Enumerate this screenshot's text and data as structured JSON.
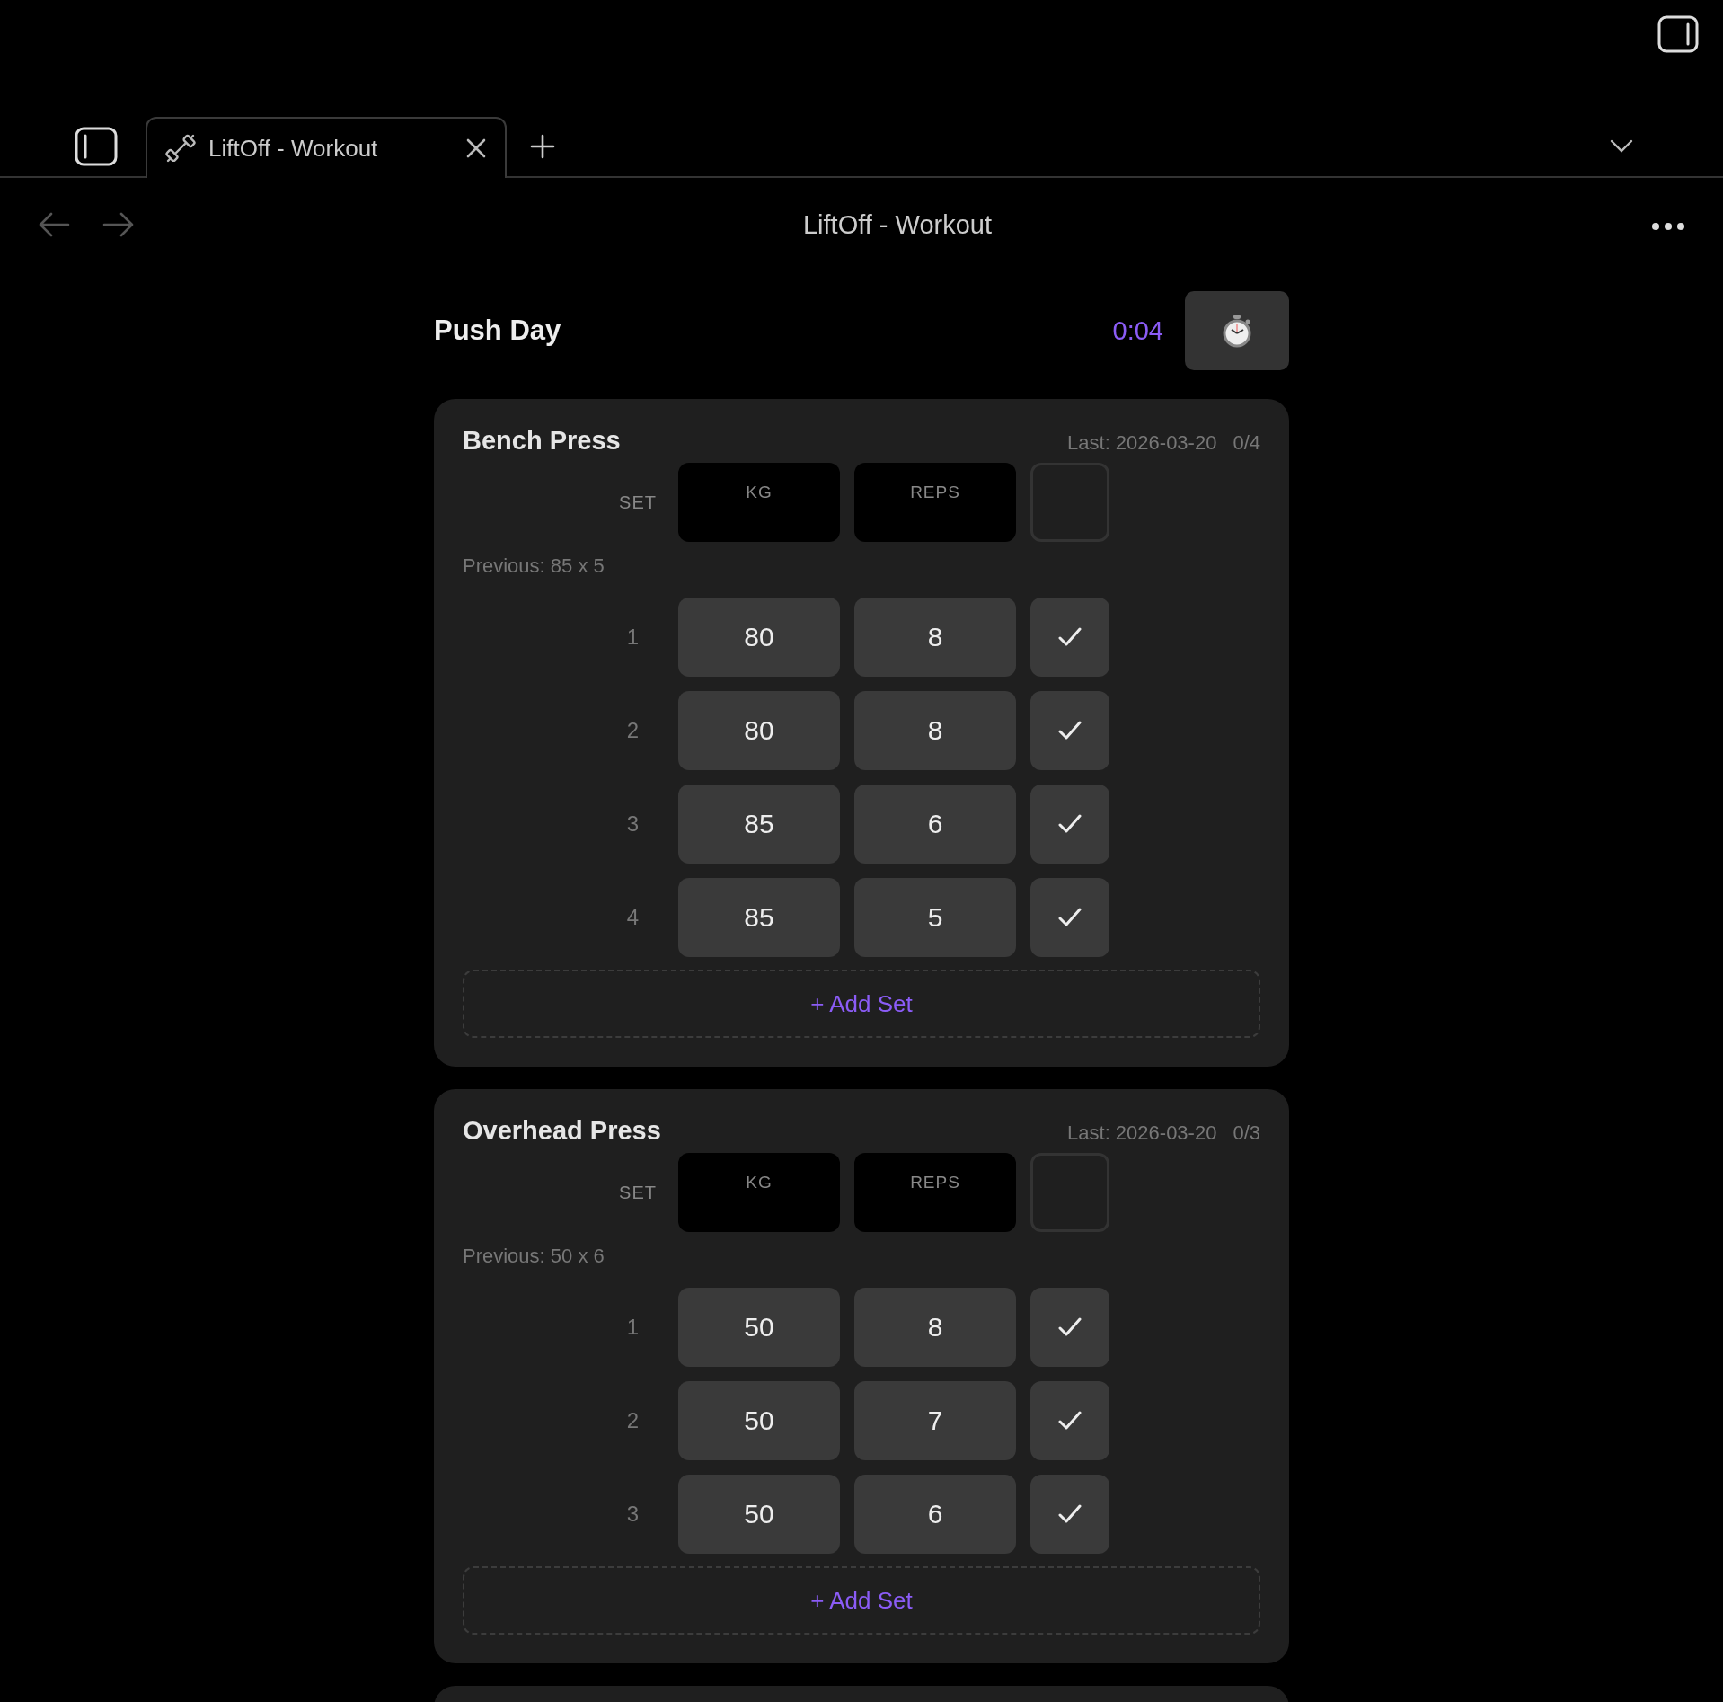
{
  "tab": {
    "title": "LiftOff - Workout",
    "selected": true
  },
  "page_title": "LiftOff - Workout",
  "workout": {
    "title": "Push Day",
    "timer": "0:04"
  },
  "exercises": [
    {
      "name": "Bench Press",
      "last": "Last: 2026-03-20",
      "progress": "0/4",
      "headers": {
        "set": "SET",
        "kg": "KG",
        "reps": "REPS"
      },
      "previous": "Previous: 85 x 5",
      "add_label": "+ Add Set",
      "sets": [
        {
          "number": "1",
          "kg": "80",
          "reps": "8",
          "done": false
        },
        {
          "number": "2",
          "kg": "80",
          "reps": "8",
          "done": false
        },
        {
          "number": "3",
          "kg": "85",
          "reps": "6",
          "done": false
        },
        {
          "number": "4",
          "kg": "85",
          "reps": "5",
          "done": false
        }
      ]
    },
    {
      "name": "Overhead Press",
      "last": "Last: 2026-03-20",
      "progress": "0/3",
      "headers": {
        "set": "SET",
        "kg": "KG",
        "reps": "REPS"
      },
      "previous": "Previous: 50 x 6",
      "add_label": "+ Add Set",
      "sets": [
        {
          "number": "1",
          "kg": "50",
          "reps": "8",
          "done": false
        },
        {
          "number": "2",
          "kg": "50",
          "reps": "7",
          "done": false
        },
        {
          "number": "3",
          "kg": "50",
          "reps": "6",
          "done": false
        }
      ]
    }
  ]
}
